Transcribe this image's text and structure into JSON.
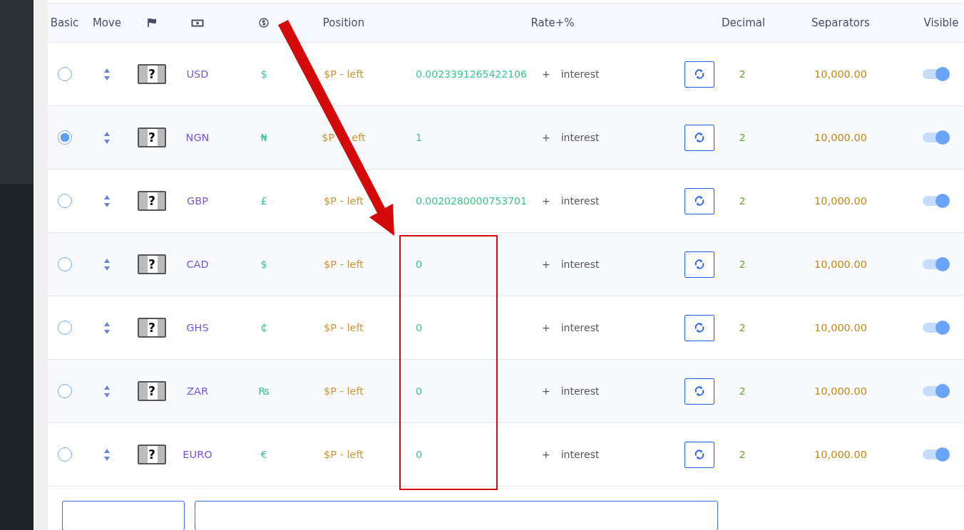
{
  "table": {
    "columns": [
      "Basic",
      "Move",
      "",
      "",
      "",
      "Position",
      "Rate+%",
      "Decimal",
      "Separators",
      "Visible"
    ],
    "rows": [
      {
        "basic_selected": false,
        "flag": "?",
        "code": "USD",
        "symbol": "$",
        "position": "$P - left",
        "rate": "0.0023391265422106",
        "plus": "+",
        "interest": "interest",
        "decimal": "2",
        "separators": "10,000.00",
        "visible": true
      },
      {
        "basic_selected": true,
        "flag": "?",
        "code": "NGN",
        "symbol": "₦",
        "position": "$P",
        "position_tail": "eft",
        "rate": "1",
        "plus": "+",
        "interest": "interest",
        "decimal": "2",
        "separators": "10,000.00",
        "visible": true
      },
      {
        "basic_selected": false,
        "flag": "?",
        "code": "GBP",
        "symbol": "£",
        "position": "$P - left",
        "rate": "0.0020280000753701",
        "plus": "+",
        "interest": "interest",
        "decimal": "2",
        "separators": "10,000.00",
        "visible": true
      },
      {
        "basic_selected": false,
        "flag": "?",
        "code": "CAD",
        "symbol": "$",
        "position": "$P - left",
        "rate": "0",
        "plus": "+",
        "interest": "interest",
        "decimal": "2",
        "separators": "10,000.00",
        "visible": true
      },
      {
        "basic_selected": false,
        "flag": "?",
        "code": "GHS",
        "symbol": "₵",
        "position": "$P - left",
        "rate": "0",
        "plus": "+",
        "interest": "interest",
        "decimal": "2",
        "separators": "10,000.00",
        "visible": true
      },
      {
        "basic_selected": false,
        "flag": "?",
        "code": "ZAR",
        "symbol": "₨",
        "position": "$P - left",
        "rate": "0",
        "plus": "+",
        "interest": "interest",
        "decimal": "2",
        "separators": "10,000.00",
        "visible": true
      },
      {
        "basic_selected": false,
        "flag": "?",
        "code": "EURO",
        "symbol": "€",
        "position": "$P - left",
        "rate": "0",
        "plus": "+",
        "interest": "interest",
        "decimal": "2",
        "separators": "10,000.00",
        "visible": true
      }
    ]
  }
}
